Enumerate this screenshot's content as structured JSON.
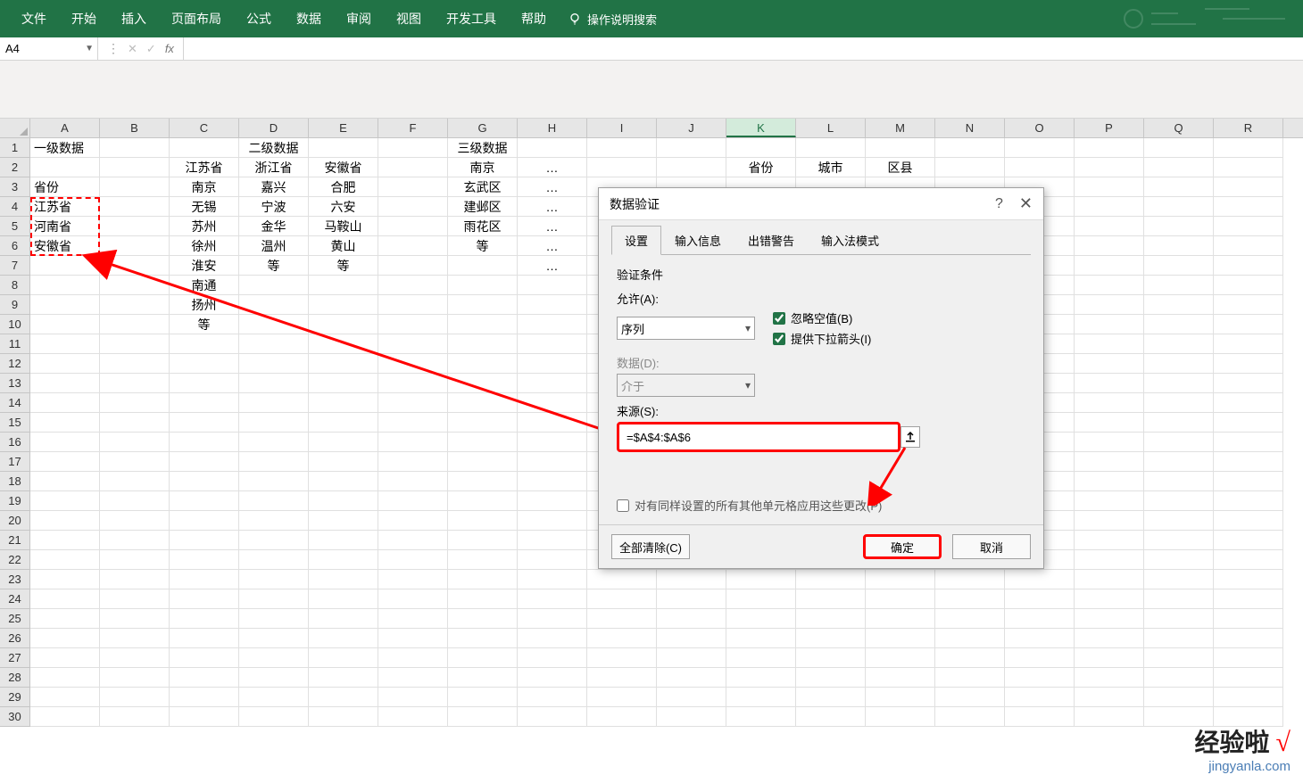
{
  "ribbon": {
    "menus": [
      "文件",
      "开始",
      "插入",
      "页面布局",
      "公式",
      "数据",
      "审阅",
      "视图",
      "开发工具",
      "帮助"
    ],
    "tell_me": "操作说明搜索"
  },
  "formula_bar": {
    "name_box": "A4",
    "formula": ""
  },
  "columns": [
    "A",
    "B",
    "C",
    "D",
    "E",
    "F",
    "G",
    "H",
    "I",
    "J",
    "K",
    "L",
    "M",
    "N",
    "O",
    "P",
    "Q",
    "R"
  ],
  "active_col": "K",
  "row_count": 30,
  "cells": {
    "A1": "一级数据",
    "D1": "二级数据",
    "G1": "三级数据",
    "C2": "江苏省",
    "D2": "浙江省",
    "E2": "安徽省",
    "G2": "南京",
    "H2": "…",
    "K2": "省份",
    "L2": "城市",
    "M2": "区县",
    "A3": "省份",
    "C3": "南京",
    "D3": "嘉兴",
    "E3": "合肥",
    "G3": "玄武区",
    "H3": "…",
    "A4": "江苏省",
    "C4": "无锡",
    "D4": "宁波",
    "E4": "六安",
    "G4": "建邺区",
    "H4": "…",
    "A5": "河南省",
    "C5": "苏州",
    "D5": "金华",
    "E5": "马鞍山",
    "G5": "雨花区",
    "H5": "…",
    "A6": "安徽省",
    "C6": "徐州",
    "D6": "温州",
    "E6": "黄山",
    "G6": "等",
    "H6": "…",
    "C7": "淮安",
    "D7": "等",
    "E7": "等",
    "H7": "…",
    "C8": "南通",
    "C9": "扬州",
    "C10": "等"
  },
  "dialog": {
    "title": "数据验证",
    "tabs": [
      "设置",
      "输入信息",
      "出错警告",
      "输入法模式"
    ],
    "section": "验证条件",
    "allow_label": "允许(A):",
    "allow_value": "序列",
    "ignore_blank": "忽略空值(B)",
    "dropdown": "提供下拉箭头(I)",
    "data_label": "数据(D):",
    "data_value": "介于",
    "source_label": "来源(S):",
    "source_value": "=$A$4:$A$6",
    "apply_all": "对有同样设置的所有其他单元格应用这些更改(P)",
    "clear": "全部清除(C)",
    "ok": "确定",
    "cancel": "取消"
  },
  "watermark": {
    "line1": "经验啦",
    "line2": "jingyanla.com"
  }
}
